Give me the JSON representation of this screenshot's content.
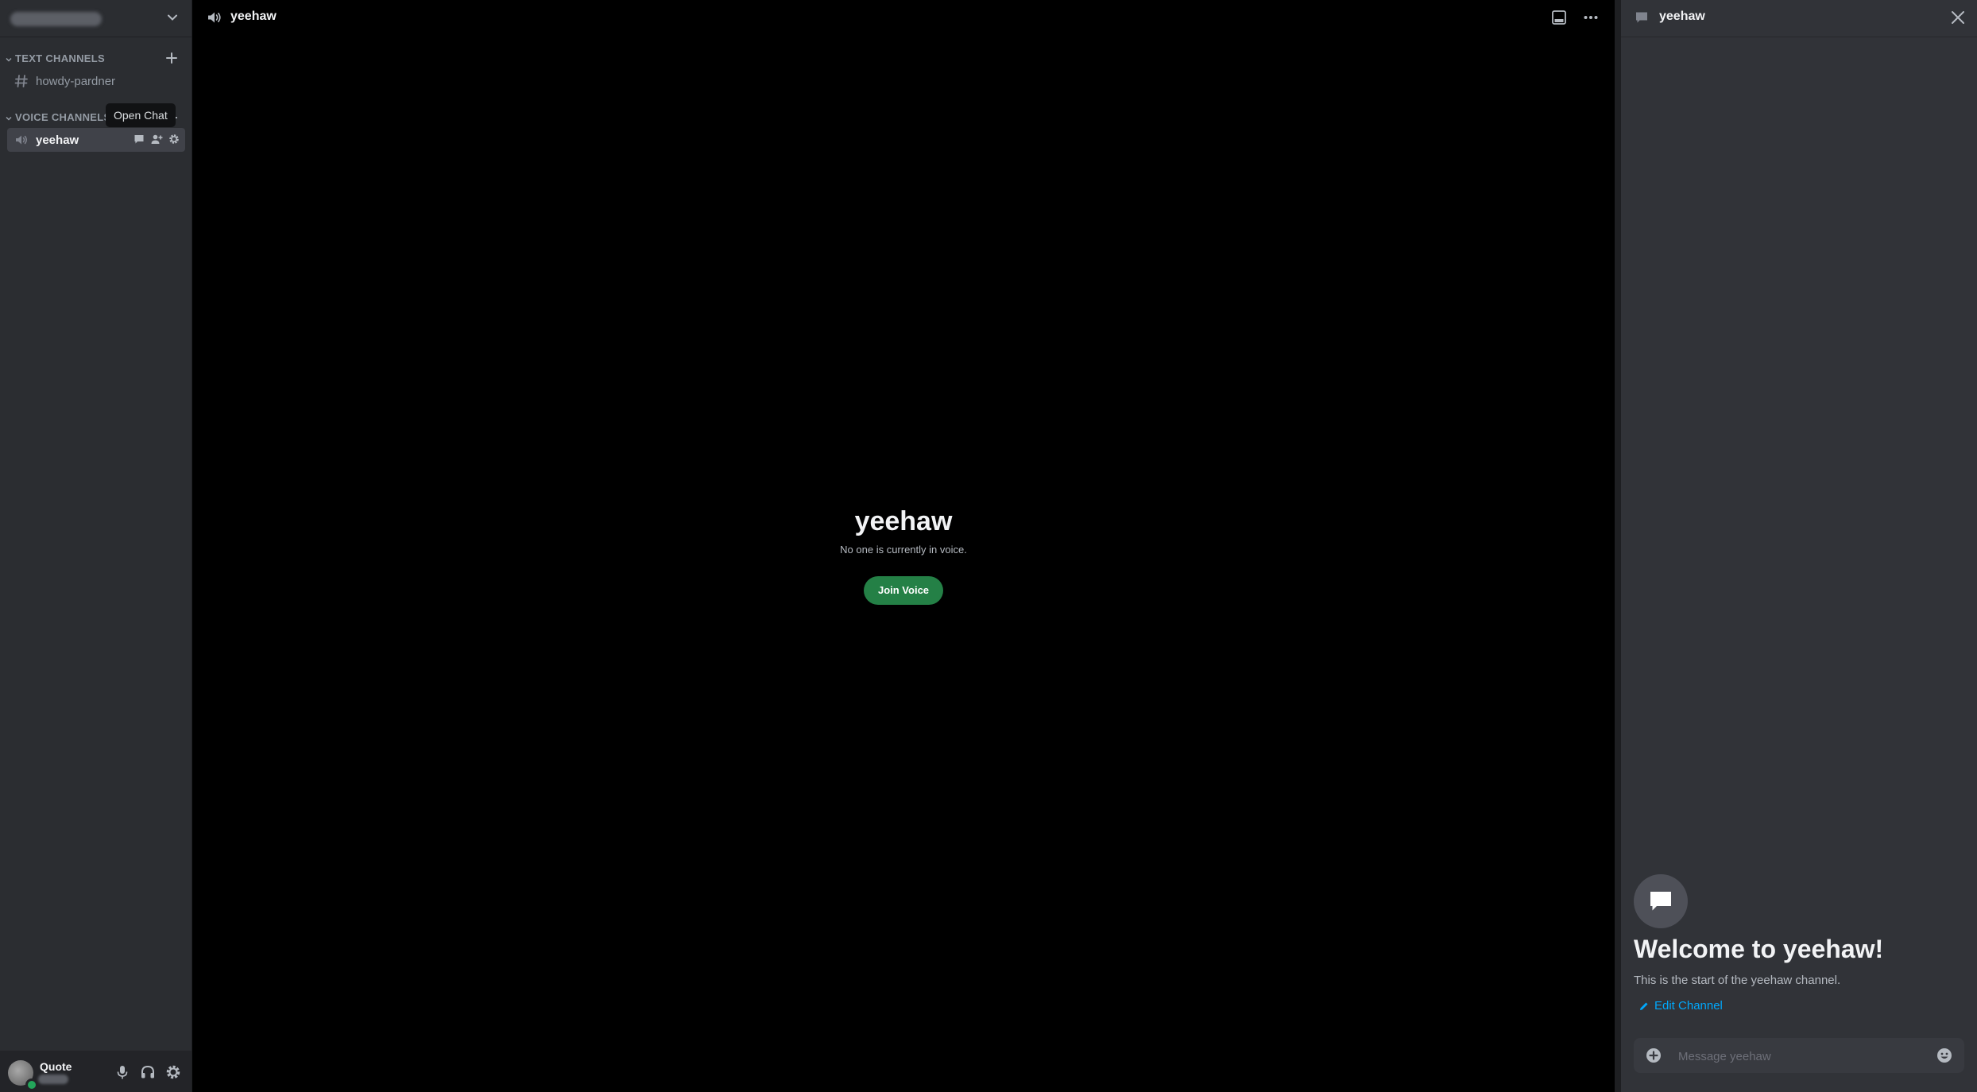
{
  "sidebar": {
    "server_name": "",
    "categories": {
      "text": "TEXT CHANNELS",
      "voice": "VOICE CHANNELS"
    },
    "text_channels": [
      {
        "label": "howdy-pardner",
        "icon": "hash-icon"
      }
    ],
    "voice_channels": [
      {
        "label": "yeehaw",
        "icon": "speaker-icon",
        "active": true
      }
    ],
    "tooltip": "Open Chat",
    "channel_actions": [
      "chat-icon",
      "invite-icon",
      "gear-icon"
    ]
  },
  "user_panel": {
    "username": "Quote",
    "status_color": "#23a55a",
    "buttons": [
      "microphone-icon",
      "headphones-icon",
      "gear-icon"
    ]
  },
  "main": {
    "header_title": "yeehaw",
    "center_title": "yeehaw",
    "center_subtitle": "No one is currently in voice.",
    "join_button": "Join Voice"
  },
  "chat": {
    "header_title": "yeehaw",
    "welcome_title": "Welcome to yeehaw!",
    "welcome_subtitle": "This is the start of the yeehaw channel.",
    "edit_channel": "Edit Channel",
    "input_placeholder": "Message yeehaw"
  },
  "colors": {
    "accent_green": "#248046",
    "link_blue": "#00a8fc",
    "sidebar_bg": "#2b2d31",
    "main_bg": "#000000",
    "chat_bg": "#313338"
  }
}
